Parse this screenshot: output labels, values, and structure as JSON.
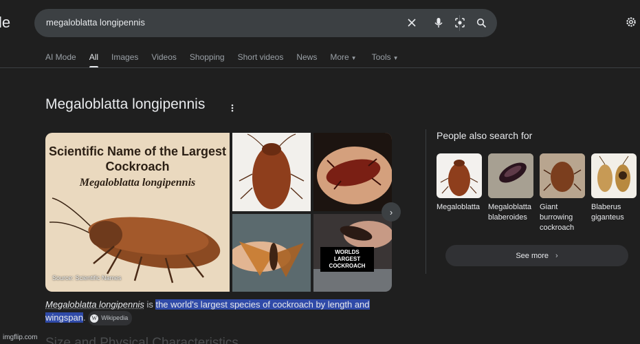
{
  "logo_fragment": "le",
  "search": {
    "query": "megaloblatta longipennis"
  },
  "tabs": [
    {
      "label": "AI Mode"
    },
    {
      "label": "All"
    },
    {
      "label": "Images"
    },
    {
      "label": "Videos"
    },
    {
      "label": "Shopping"
    },
    {
      "label": "Short videos"
    },
    {
      "label": "News"
    },
    {
      "label": "More"
    },
    {
      "label": "Tools"
    }
  ],
  "knowledge_panel": {
    "title": "Megaloblatta longipennis",
    "main_image": {
      "heading": "Scientific Name of the Largest Cockroach",
      "species": "Megaloblatta longipennis",
      "source": "Source: Scientific Names"
    },
    "tile_tag": "WORLDS LARGEST COCKROACH",
    "snippet": {
      "term": "Megaloblatta longipennis",
      "connector": "is",
      "highlight_1": "the world's largest species of cockroach by length and",
      "highlight_2": "wingspan",
      "end": ".",
      "source_chip": "Wikipedia"
    },
    "next_section": "Size and Physical Characteristics"
  },
  "people_also_search": {
    "title": "People also search for",
    "items": [
      {
        "label": "Megaloblatta"
      },
      {
        "label": "Megaloblatta blaberoides"
      },
      {
        "label": "Giant burrowing cockroach"
      },
      {
        "label": "Blaberus giganteus"
      }
    ],
    "see_more": "See more"
  },
  "watermark": "imgflip.com",
  "colors": {
    "background": "#1f1f1f",
    "search_bar": "#3c4043",
    "highlight": "#2f4aa8",
    "main_image_bg": "#ead9bf"
  },
  "icons": [
    "clear-icon",
    "mic-icon",
    "lens-icon",
    "search-icon",
    "settings-icon",
    "more-vert-icon",
    "chevron-right-icon"
  ]
}
